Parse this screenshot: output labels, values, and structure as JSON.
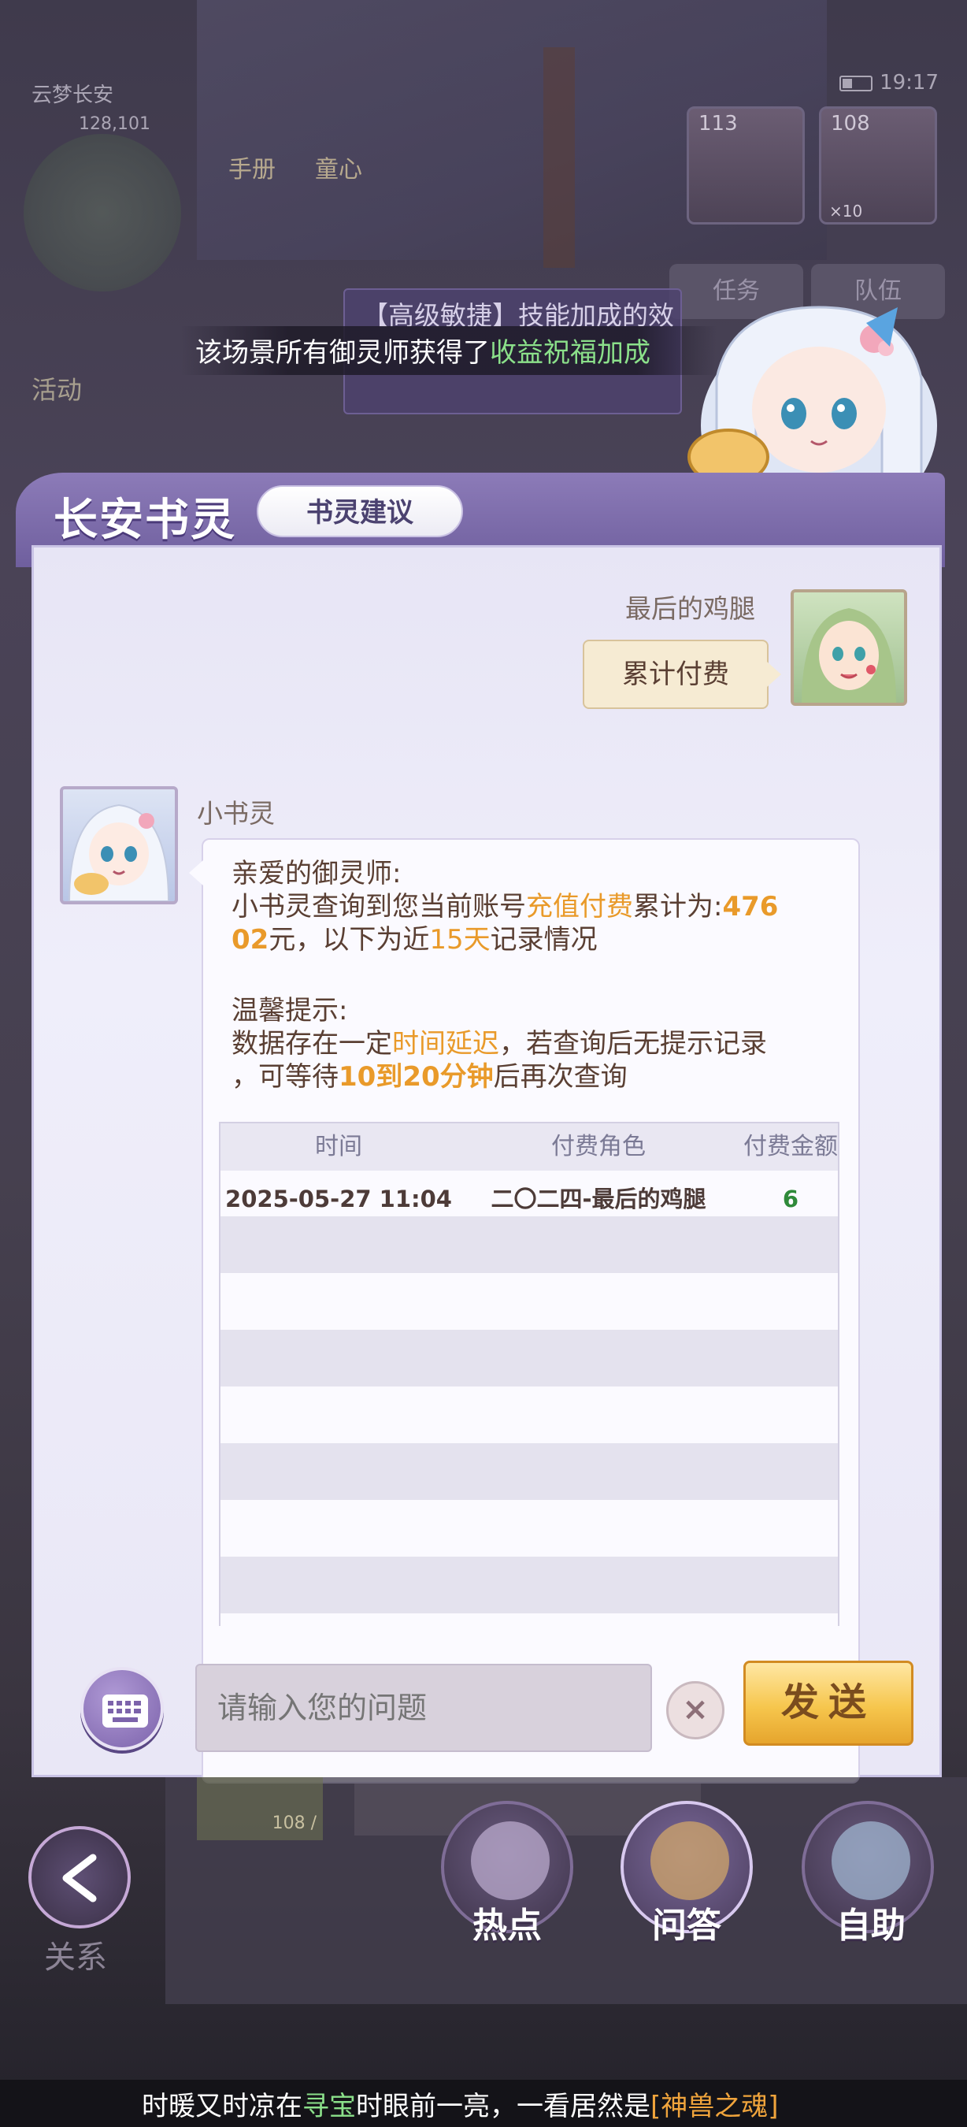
{
  "hud": {
    "location": "云梦长安",
    "coords": "128,101",
    "icons": [
      "手册",
      "童心"
    ],
    "portraits": [
      "113",
      "108"
    ],
    "portrait_sub": "×10",
    "time": "19:17",
    "tabs": [
      "任务",
      "队伍"
    ],
    "activity": "活动"
  },
  "notices": {
    "skill_notice": "【高级敏捷】技能加成的效",
    "broadcast_prefix": "该场景所有御灵师获得了",
    "broadcast_highlight": "收益祝福加成"
  },
  "panel": {
    "title": "长安书灵",
    "tab_label": "书灵建议"
  },
  "chat": {
    "user": {
      "name": "最后的鸡腿",
      "message": "累计付费"
    },
    "bot": {
      "name": "小书灵",
      "greeting": "亲爱的御灵师:",
      "line1_a": "小书灵查询到您当前账号",
      "line1_hl": "充值付费",
      "line1_b": "累计为:",
      "line1_amount": "476",
      "line2_amount": "02",
      "line2_a": "元，以下为近",
      "line2_hl": "15天",
      "line2_b": "记录情况",
      "tip_title": "温馨提示:",
      "tip1_a": "数据存在一定",
      "tip1_hl": "时间延迟",
      "tip1_b": "，若查询后无提示记录",
      "tip2_a": "，可等待",
      "tip2_hl": "10到20分钟",
      "tip2_b": "后再次查询"
    },
    "table": {
      "headers": [
        "时间",
        "付费角色",
        "付费金额"
      ],
      "rows": [
        {
          "time": "2025-05-27 11:04",
          "role": "二〇二四-最后的鸡腿",
          "amount": "6"
        }
      ]
    }
  },
  "input": {
    "placeholder": "请输入您的问题",
    "clear": "×",
    "send": "发送"
  },
  "bottom": {
    "relations": "关系",
    "buttons": [
      "热点",
      "问答",
      "自助"
    ],
    "tiger_card": "108 /"
  },
  "ticker": {
    "a": "时暖又时凉在",
    "b": "寻宝",
    "c": "时眼前一亮，一看居然是",
    "d": "[神兽之魂]"
  },
  "colors": {
    "highlight": "#e99a2a",
    "amount_green": "#2f8a3a",
    "send_gold": "#f6c64d",
    "panel_purple": "#7a6aa8"
  }
}
